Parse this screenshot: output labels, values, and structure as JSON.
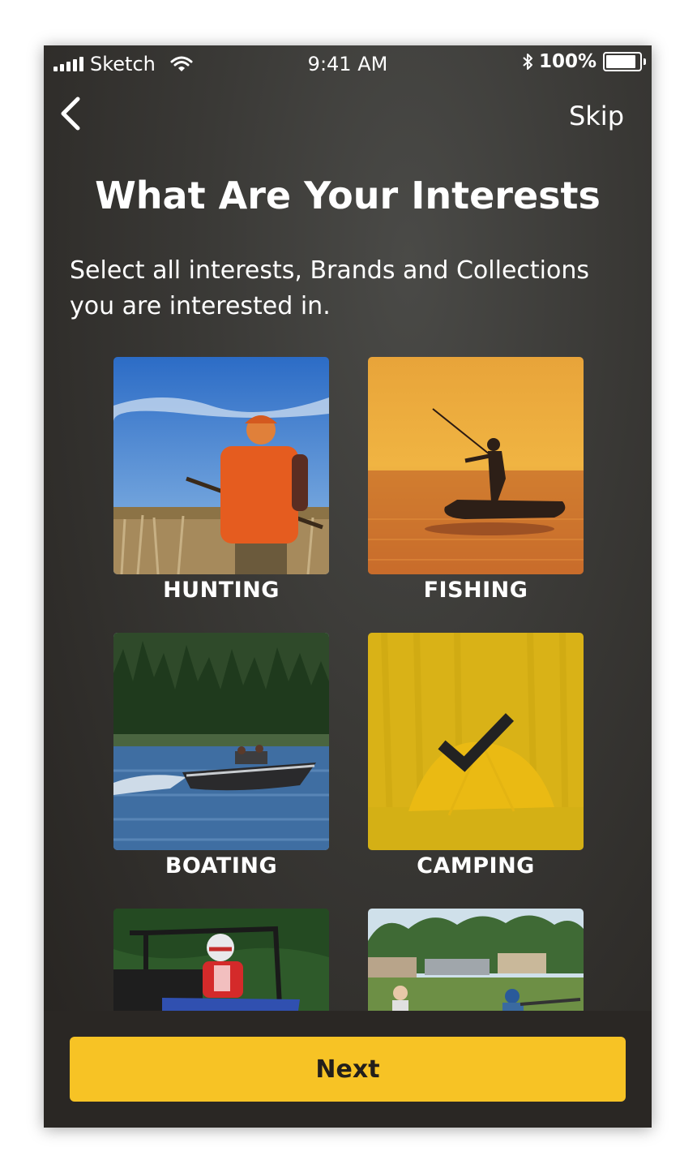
{
  "status_bar": {
    "carrier": "Sketch",
    "time": "9:41 AM",
    "battery": "100%",
    "battery_level": 1.0
  },
  "nav": {
    "skip_label": "Skip"
  },
  "header": {
    "title": "What Are Your Interests",
    "subtitle": "Select all interests, Brands and Collections you are interested in."
  },
  "interests": [
    {
      "label": "HUNTING",
      "selected": false
    },
    {
      "label": "FISHING",
      "selected": false
    },
    {
      "label": "BOATING",
      "selected": false
    },
    {
      "label": "CAMPING",
      "selected": true
    },
    {
      "label": "",
      "selected": false
    },
    {
      "label": "",
      "selected": false
    }
  ],
  "footer": {
    "next_label": "Next"
  },
  "colors": {
    "accent": "#f7c325",
    "selected_overlay": "#eabe12",
    "background": "#3a3936"
  }
}
